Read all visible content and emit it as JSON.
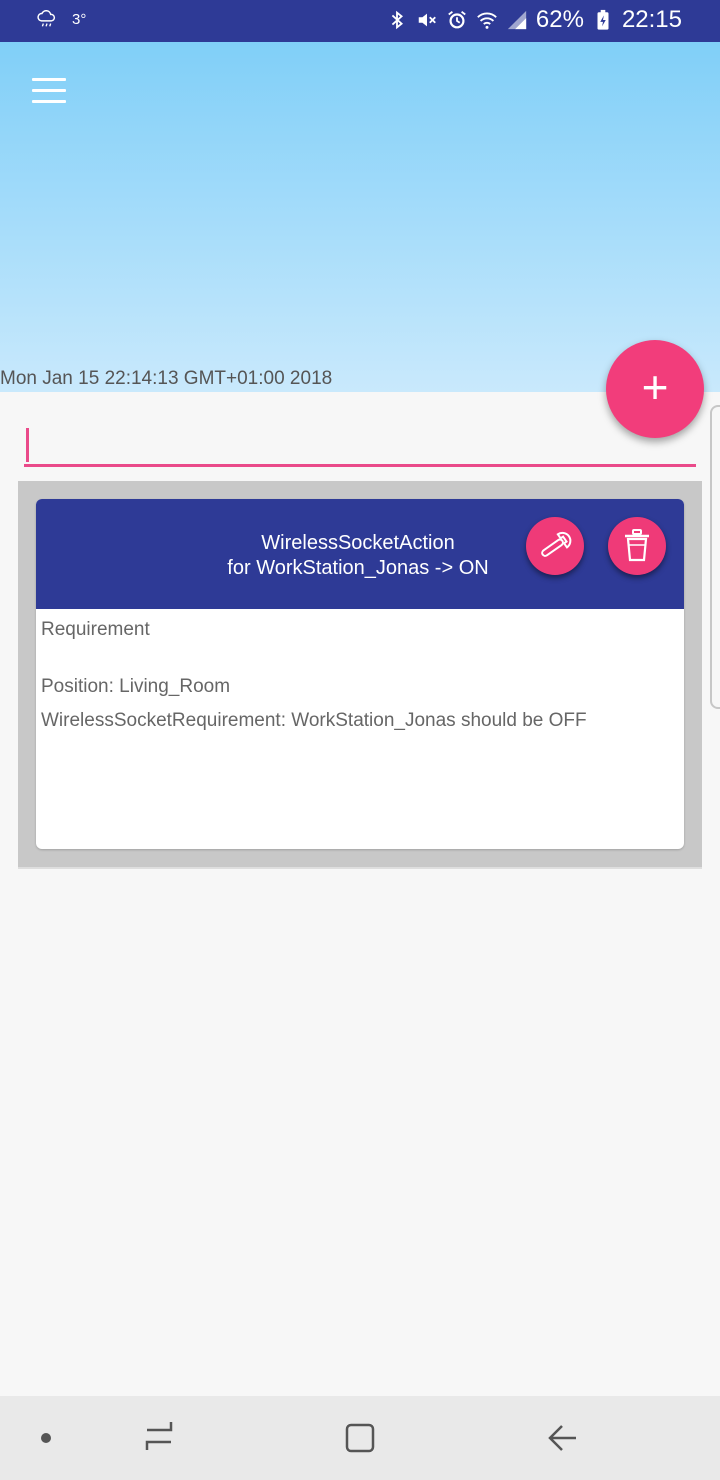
{
  "status_bar": {
    "temperature": "3°",
    "battery": "62%",
    "time": "22:15"
  },
  "header": {
    "date": "Mon Jan 15 22:14:13 GMT+01:00 2018"
  },
  "search": {
    "value": ""
  },
  "card": {
    "title_line1": "WirelessSocketAction",
    "title_line2": "for WorkStation_Jonas -> ON",
    "requirement_title": "Requirement",
    "position": "Position: Living_Room",
    "requirement_detail": "WirelessSocketRequirement: WorkStation_Jonas should be OFF"
  },
  "colors": {
    "primary": "#2e3a96",
    "accent": "#f23d7b",
    "header_top": "#80cff8",
    "header_bottom": "#c9e9fc"
  },
  "icons": {
    "weather": "cloud-rain-icon",
    "bluetooth": "bluetooth-icon",
    "mute": "mute-icon",
    "alarm": "alarm-icon",
    "wifi": "wifi-icon",
    "signal": "signal-icon",
    "battery": "battery-charging-icon",
    "menu": "menu-icon",
    "add": "plus-icon",
    "edit": "wrench-icon",
    "delete": "trash-icon"
  }
}
